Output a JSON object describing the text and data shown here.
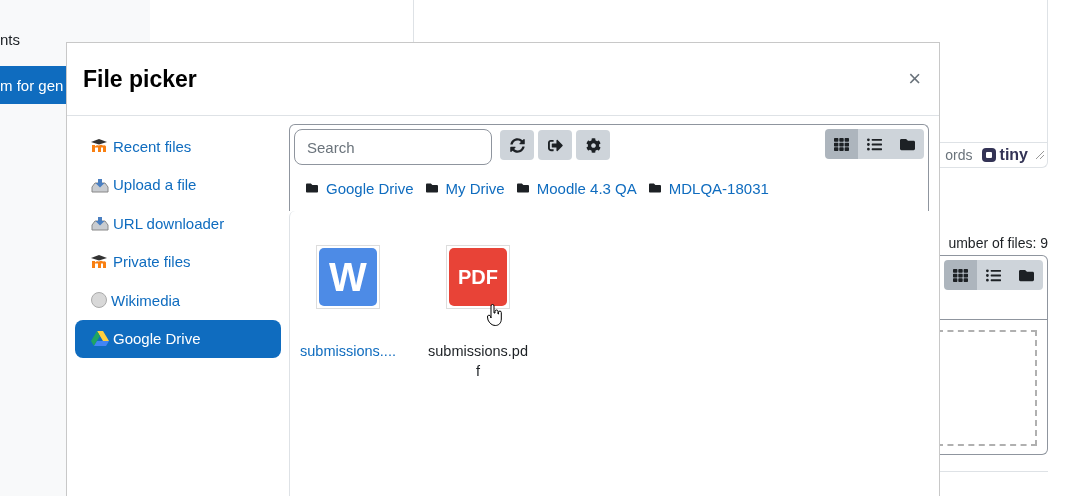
{
  "background": {
    "sidebar_items": [
      {
        "label": "nts",
        "selected": false
      },
      {
        "label": "m for gen",
        "selected": true
      }
    ],
    "editor_footer": {
      "word_count": "ords",
      "brand": "tiny"
    },
    "file_count": "umber of files: 9",
    "file_manager_views": [
      {
        "kind": "grid",
        "selected": true
      },
      {
        "kind": "list",
        "selected": false
      },
      {
        "kind": "tree",
        "selected": false
      }
    ]
  },
  "dialog": {
    "title": "File picker",
    "close": "×",
    "repositories": [
      {
        "label": "Recent files",
        "kind": "moodle",
        "selected": false
      },
      {
        "label": "Upload a file",
        "kind": "upload",
        "selected": false
      },
      {
        "label": "URL downloader",
        "kind": "upload",
        "selected": false
      },
      {
        "label": "Private files",
        "kind": "moodle",
        "selected": false
      },
      {
        "label": "Wikimedia",
        "kind": "wiki",
        "selected": false
      },
      {
        "label": "Google Drive",
        "kind": "drive",
        "selected": true
      }
    ],
    "search": {
      "placeholder": "Search"
    },
    "toolbar": [
      {
        "kind": "refresh"
      },
      {
        "kind": "logout"
      },
      {
        "kind": "settings"
      }
    ],
    "views": [
      {
        "kind": "grid",
        "selected": true
      },
      {
        "kind": "list",
        "selected": false
      },
      {
        "kind": "tree",
        "selected": false
      }
    ],
    "breadcrumb": [
      "Google Drive",
      "My Drive",
      "Moodle 4.3 QA",
      "MDLQA-18031"
    ],
    "files": [
      {
        "name": "submissions....",
        "kind": "word",
        "badge": "W",
        "hovered": false
      },
      {
        "name": "submissions.pdf",
        "kind": "pdf",
        "badge": "PDF",
        "hovered": true
      }
    ]
  }
}
